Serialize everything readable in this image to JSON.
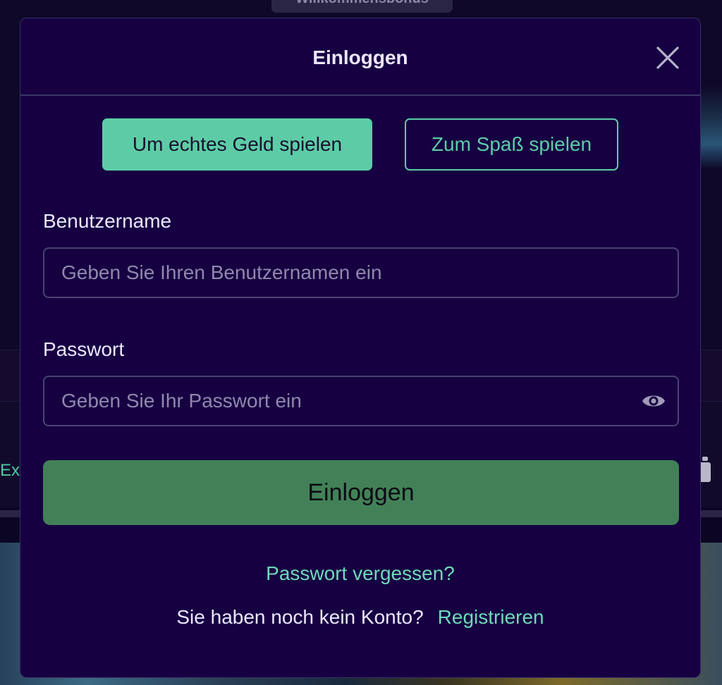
{
  "background": {
    "tab_label": "Willkommensbonus",
    "left_text": "Exk"
  },
  "modal": {
    "title": "Einloggen",
    "close_icon": "close-icon",
    "mode_buttons": {
      "real_money": "Um echtes Geld spielen",
      "fun": "Zum Spaß spielen"
    },
    "username": {
      "label": "Benutzername",
      "placeholder": "Geben Sie Ihren Benutzernamen ein",
      "value": ""
    },
    "password": {
      "label": "Passwort",
      "placeholder": "Geben Sie Ihr Passwort ein",
      "value": "",
      "toggle_icon": "eye-icon"
    },
    "submit_label": "Einloggen",
    "forgot_password": "Passwort vergessen?",
    "no_account_text": "Sie haben noch kein Konto?",
    "register_link": "Registrieren"
  },
  "colors": {
    "modal_background": "#160042",
    "accent": "#5dcca6",
    "submit_button": "#428158",
    "link": "#6fd8b8",
    "text": "#ece6ff"
  }
}
